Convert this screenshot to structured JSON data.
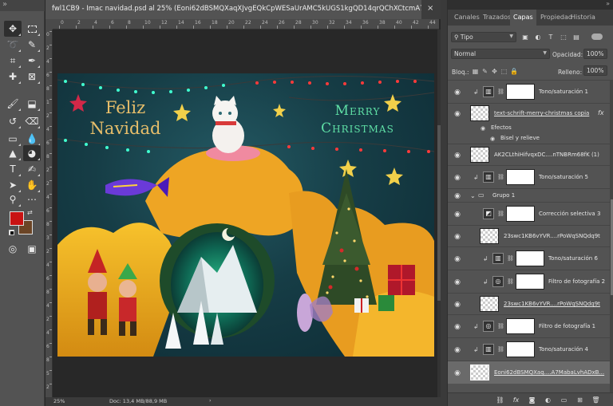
{
  "document": {
    "tab_title": "fwl1CB9 - Imac navidad.psd al 25% (Eoni62dBSMQXaqXJvgEQkCpWESaUrAMC5kUGS1kgQD14qrQChXCtcmA7M...",
    "close_glyph": "×",
    "zoom": "25%",
    "doc_size": "Doc: 13,4 MB/88,9 MB",
    "status_arrow": "›"
  },
  "rulers": {
    "top": [
      "0",
      "2",
      "4",
      "6",
      "8",
      "10",
      "12",
      "14",
      "16",
      "18",
      "20",
      "22",
      "24",
      "26",
      "28",
      "30",
      "32",
      "34",
      "36",
      "38",
      "40",
      "42",
      "44",
      "46"
    ],
    "left": [
      "0",
      "2",
      "4",
      "6",
      "8",
      "1",
      "2",
      "4",
      "6",
      "8",
      "2",
      "2",
      "4",
      "6",
      "8",
      "3",
      "2",
      "4",
      "6",
      "8",
      "4",
      "2",
      "4",
      "6",
      "8",
      "5",
      "2"
    ]
  },
  "artwork": {
    "title_left_line1": "Feliz",
    "title_left_line2": "Navidad",
    "title_right_line1": "Merry",
    "title_right_line2": "Christmas"
  },
  "toolbar": {
    "tools": [
      "move-tool",
      "marquee-tool",
      "lasso-tool",
      "quick-select-tool",
      "crop-tool",
      "eyedropper-tool",
      "healing-brush-tool",
      "brush-tool",
      "clone-stamp-tool",
      "history-brush-tool",
      "eraser-tool",
      "gradient-tool",
      "blur-tool",
      "dodge-tool",
      "pen-tool",
      "type-tool",
      "path-select-tool",
      "shape-tool",
      "hand-tool",
      "zoom-tool",
      "more-tools"
    ],
    "foreground_color": "#c81212",
    "background_color": "#6b4526"
  },
  "panel": {
    "tabs": [
      "Canales",
      "Trazados",
      "Capas",
      "Propiedad",
      "Historia"
    ],
    "active_tab": "Capas",
    "filter_label": "Tipo",
    "blend_mode": "Normal",
    "opacity_label": "Opacidad:",
    "opacity_value": "100%",
    "lock_label": "Bloq.:",
    "fill_label": "Relleno:",
    "fill_value": "100%",
    "layers": [
      {
        "name": "Tono/saturación 1",
        "kind": "adjustment",
        "clipped": true
      },
      {
        "name": "text-schrift-merry-christmas copia",
        "kind": "pixel",
        "fx": "fx"
      },
      {
        "name": "Efectos",
        "kind": "effects-header"
      },
      {
        "name": "Bisel y relieve",
        "kind": "effect"
      },
      {
        "name": "AK2CLthiHifvqxDC....nTNBRm68fK (1)",
        "kind": "pixel"
      },
      {
        "name": "Tono/saturación 5",
        "kind": "adjustment",
        "clipped": true
      },
      {
        "name": "Grupo 1",
        "kind": "group"
      },
      {
        "name": "Corrección selectiva 3",
        "kind": "adjustment"
      },
      {
        "name": "23swc1KB6vYVR....rPoWqSNQdq9t",
        "kind": "pixel"
      },
      {
        "name": "Tono/saturación 6",
        "kind": "adjustment",
        "clipped": true
      },
      {
        "name": "Filtro de fotografía 2",
        "kind": "adjustment",
        "clipped": true
      },
      {
        "name": "23swc1KB6vYVR....rPoWqSNQdq9t",
        "kind": "pixel"
      },
      {
        "name": "Filtro de fotografía 1",
        "kind": "adjustment",
        "clipped": true
      },
      {
        "name": "Tono/saturación 4",
        "kind": "adjustment",
        "clipped": true
      },
      {
        "name": "Eoni62dBSMQXaq....A7MabaLvhADxB...",
        "kind": "pixel",
        "selected": true
      }
    ],
    "bottom_icons": [
      "link-icon",
      "fx-icon",
      "mask-icon",
      "adjustment-icon",
      "folder-icon",
      "new-layer-icon",
      "trash-icon"
    ]
  }
}
